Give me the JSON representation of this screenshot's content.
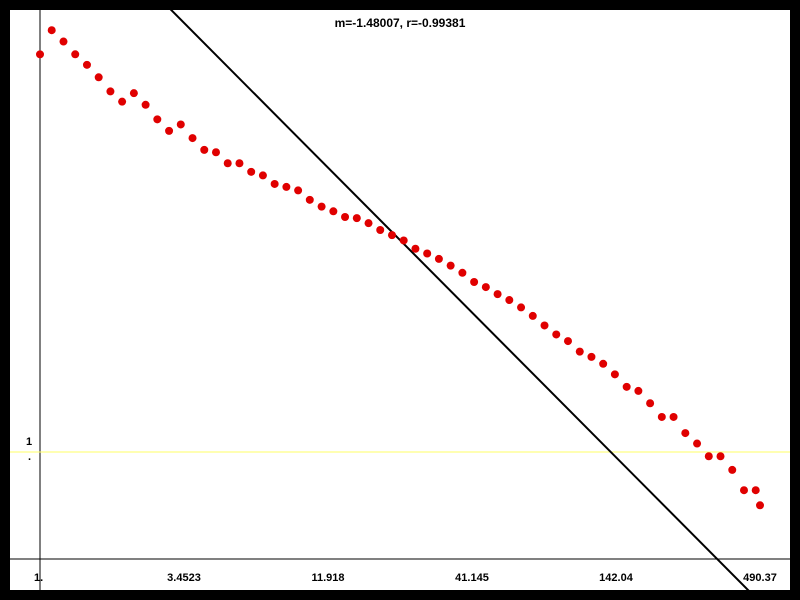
{
  "chart_data": {
    "type": "scatter",
    "title": "m=-1.48007, r=-0.99381",
    "x_scale": "log",
    "y_scale": "log",
    "xlim": [
      1,
      490.37
    ],
    "x_tick_labels": [
      "1.",
      "3.4523",
      "11.918",
      "41.145",
      "142.04",
      "490.37"
    ],
    "y_tick_labels": [
      "1",
      "."
    ],
    "reference_line_y": 1,
    "fit": {
      "slope": -1.48007,
      "r": -0.99381
    },
    "colors": {
      "points": "#e00000",
      "fit_line": "#000000",
      "reference_line": "#ffff66",
      "background": "#ffffff",
      "frame": "#000000"
    },
    "grid": false,
    "series": [
      {
        "values": [
          [
            1.0,
            6042
          ],
          [
            1.106,
            8199
          ],
          [
            1.224,
            7104
          ],
          [
            1.354,
            6045
          ],
          [
            1.498,
            5288
          ],
          [
            1.657,
            4518
          ],
          [
            1.833,
            3778
          ],
          [
            2.027,
            3317
          ],
          [
            2.243,
            3695
          ],
          [
            2.481,
            3189
          ],
          [
            2.744,
            2653
          ],
          [
            3.036,
            2292
          ],
          [
            3.358,
            2486
          ],
          [
            3.715,
            2092
          ],
          [
            4.11,
            1802
          ],
          [
            4.546,
            1748
          ],
          [
            5.029,
            1521
          ],
          [
            5.563,
            1521
          ],
          [
            6.154,
            1364
          ],
          [
            6.808,
            1304
          ],
          [
            7.531,
            1170
          ],
          [
            8.331,
            1127
          ],
          [
            9.216,
            1078
          ],
          [
            10.19,
            957
          ],
          [
            11.28,
            878
          ],
          [
            12.48,
            828
          ],
          [
            13.8,
            770
          ],
          [
            15.27,
            759
          ],
          [
            16.89,
            712
          ],
          [
            18.68,
            653
          ],
          [
            20.67,
            612
          ],
          [
            22.86,
            572
          ],
          [
            25.29,
            515
          ],
          [
            27.98,
            485
          ],
          [
            30.95,
            453
          ],
          [
            34.24,
            416
          ],
          [
            37.88,
            380
          ],
          [
            41.9,
            338
          ],
          [
            46.35,
            317
          ],
          [
            51.28,
            290
          ],
          [
            56.72,
            269
          ],
          [
            62.75,
            245
          ],
          [
            69.42,
            220
          ],
          [
            76.79,
            195
          ],
          [
            84.95,
            174
          ],
          [
            93.98,
            160
          ],
          [
            104.0,
            140
          ],
          [
            115.0,
            131
          ],
          [
            127.2,
            120
          ],
          [
            140.7,
            105
          ],
          [
            155.7,
            89.6
          ],
          [
            172.2,
            85.1
          ],
          [
            190.5,
            72.8
          ],
          [
            210.7,
            61.2
          ],
          [
            233.1,
            61.2
          ],
          [
            257.9,
            49.9
          ],
          [
            285.3,
            43.7
          ],
          [
            315.6,
            37.2
          ],
          [
            349.1,
            37.2
          ],
          [
            386.2,
            31.3
          ],
          [
            427.3,
            24.2
          ],
          [
            472.6,
            24.2
          ],
          [
            490.37,
            20.0
          ]
        ]
      }
    ]
  }
}
